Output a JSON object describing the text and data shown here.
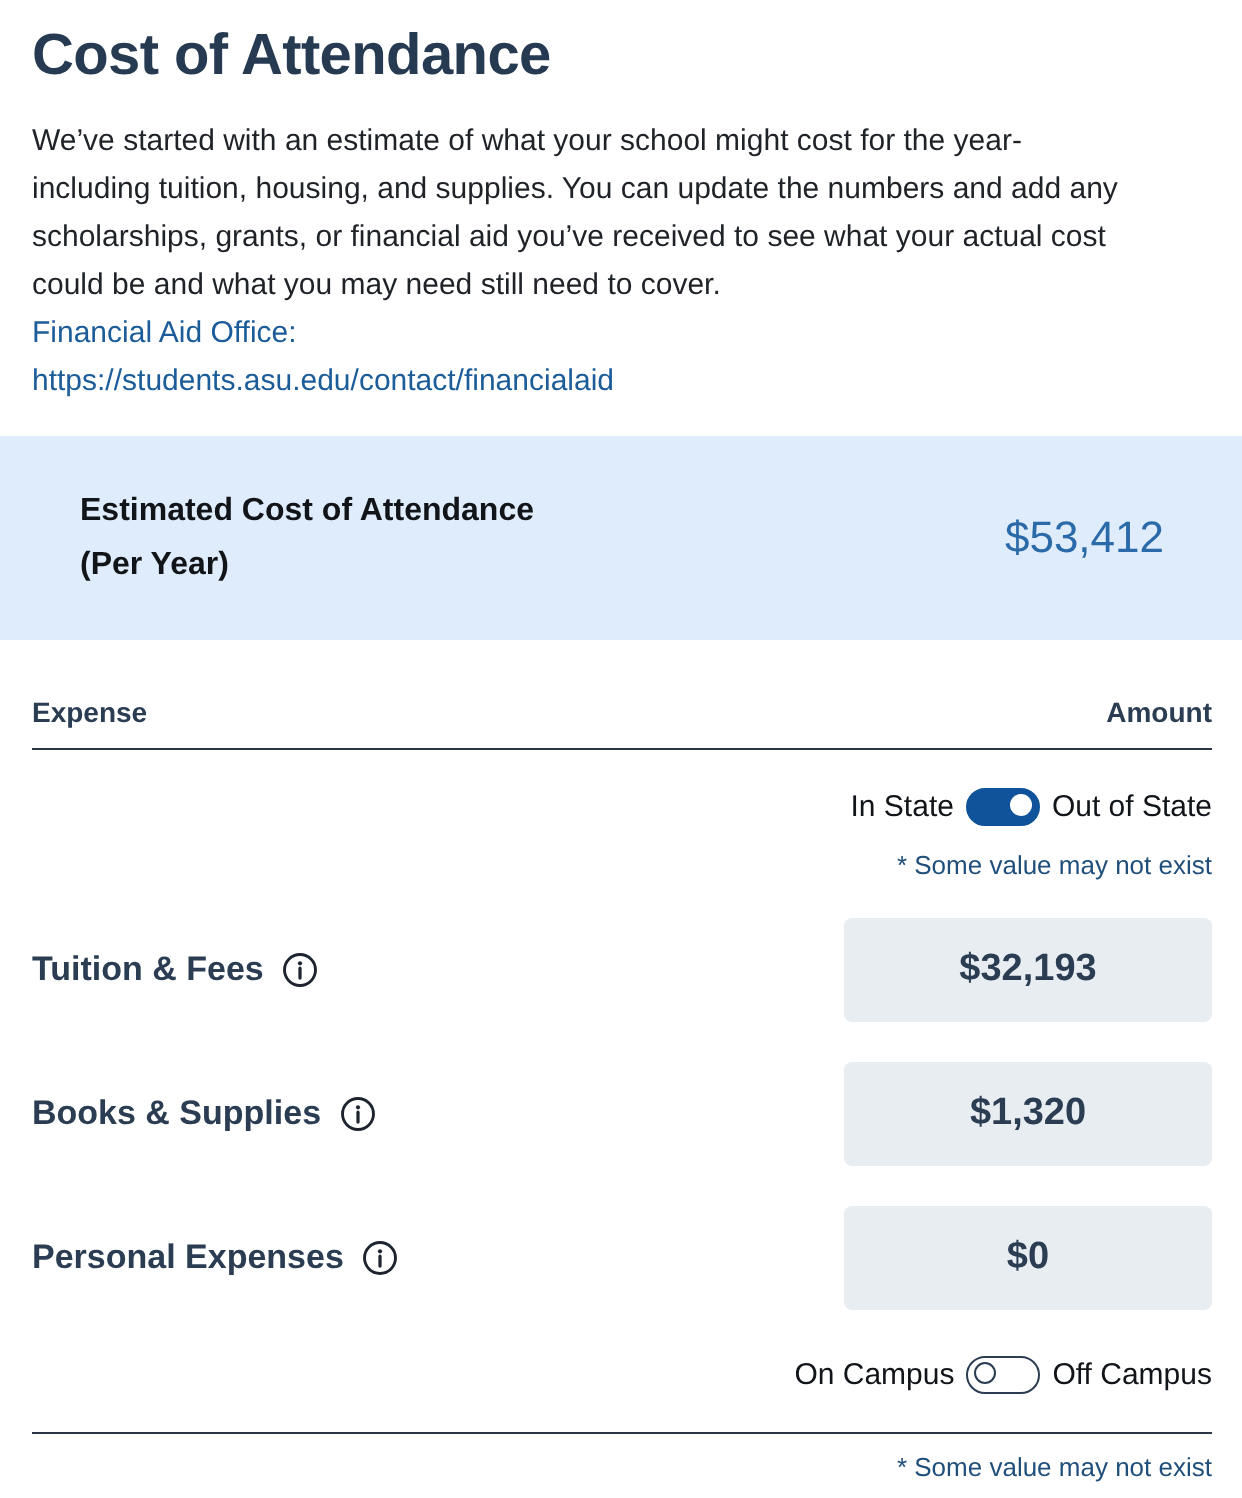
{
  "title": "Cost of Attendance",
  "intro": "We’ve started with an estimate of what your school might cost for the year-including tuition, housing, and supplies. You can update the numbers and add any scholarships, grants, or financial aid you’ve received to see what your actual cost could be and what you may need still need to cover.",
  "financial_aid": {
    "label": "Financial Aid Office:",
    "url": "https://students.asu.edu/contact/financialaid"
  },
  "estimate": {
    "label": "Estimated Cost of Attendance (Per Year)",
    "amount": "$53,412"
  },
  "table": {
    "columns": [
      "Expense",
      "Amount"
    ],
    "residency_toggle": {
      "left_label": "In State",
      "right_label": "Out of State",
      "on": true
    },
    "note": "* Some value may not exist",
    "rows": [
      {
        "label": "Tuition & Fees",
        "value": "$32,193"
      },
      {
        "label": "Books & Supplies",
        "value": "$1,320"
      },
      {
        "label": "Personal Expenses",
        "value": "$0"
      }
    ],
    "housing_toggle": {
      "left_label": "On Campus",
      "right_label": "Off Campus",
      "on": false
    },
    "footer_note": "* Some value may not exist"
  }
}
